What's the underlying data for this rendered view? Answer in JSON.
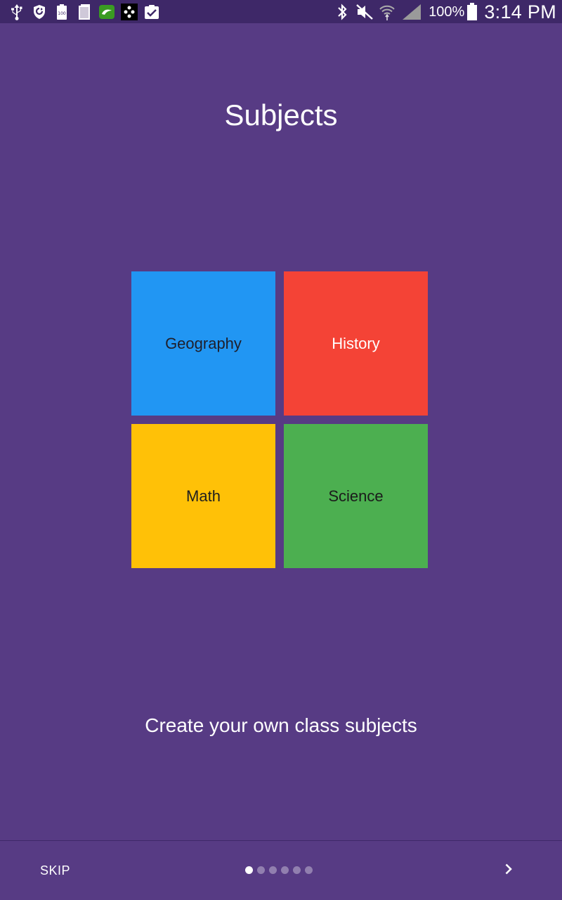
{
  "status_bar": {
    "left_icons": [
      "usb-icon",
      "shield-icon",
      "battery-100-icon",
      "sim-card-icon",
      "green-app-icon",
      "checkers-app-icon",
      "clipboard-check-icon"
    ],
    "right_icons": [
      "bluetooth-icon",
      "mute-icon",
      "wifi-icon",
      "signal-icon"
    ],
    "battery_percent": "100%",
    "time": "3:14 PM"
  },
  "page": {
    "title": "Subjects",
    "description": "Create your own class subjects"
  },
  "tiles": [
    {
      "label": "Geography",
      "color": "#2196F3"
    },
    {
      "label": "History",
      "color": "#F44336"
    },
    {
      "label": "Math",
      "color": "#FFC107"
    },
    {
      "label": "Science",
      "color": "#4CAF50"
    }
  ],
  "nav": {
    "skip_label": "SKIP",
    "page_count": 6,
    "current_page": 1,
    "next_icon": "chevron-right-icon"
  },
  "colors": {
    "background": "#573B84",
    "status_bar": "#3E2868"
  }
}
